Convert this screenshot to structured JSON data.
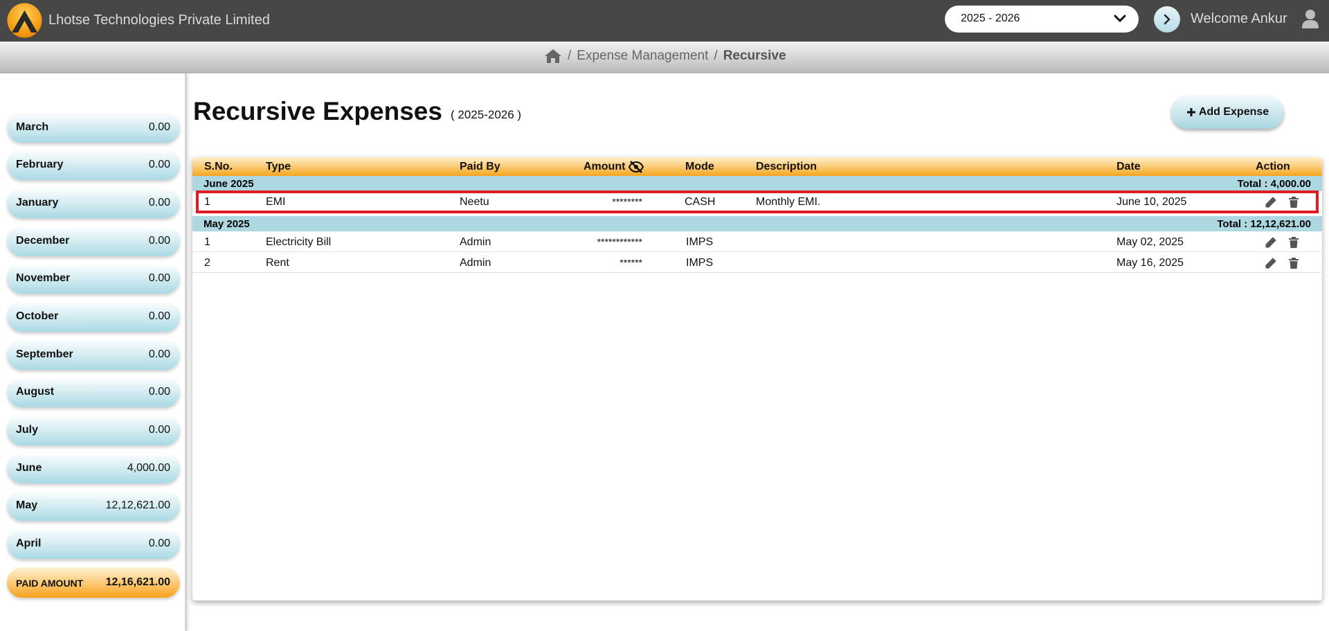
{
  "header": {
    "company": "Lhotse Technologies Private Limited",
    "financial_year": "2025 - 2026",
    "welcome": "Welcome Ankur"
  },
  "breadcrumb": {
    "section": "Expense Management",
    "current": "Recursive"
  },
  "sidebar": {
    "months": [
      {
        "name": "March",
        "amount": "0.00"
      },
      {
        "name": "February",
        "amount": "0.00"
      },
      {
        "name": "January",
        "amount": "0.00"
      },
      {
        "name": "December",
        "amount": "0.00"
      },
      {
        "name": "November",
        "amount": "0.00"
      },
      {
        "name": "October",
        "amount": "0.00"
      },
      {
        "name": "September",
        "amount": "0.00"
      },
      {
        "name": "August",
        "amount": "0.00"
      },
      {
        "name": "July",
        "amount": "0.00"
      },
      {
        "name": "June",
        "amount": "4,000.00"
      },
      {
        "name": "May",
        "amount": "12,12,621.00"
      },
      {
        "name": "April",
        "amount": "0.00"
      }
    ],
    "paid_label": "PAID AMOUNT",
    "paid_total": "12,16,621.00"
  },
  "page": {
    "title": "Recursive Expenses",
    "subtitle": "( 2025-2026 )",
    "add_button": "Add Expense"
  },
  "table": {
    "columns": {
      "sno": "S.No.",
      "type": "Type",
      "paid_by": "Paid By",
      "amount": "Amount",
      "mode": "Mode",
      "description": "Description",
      "date": "Date",
      "action": "Action"
    },
    "groups": [
      {
        "name": "June 2025",
        "total": "Total : 4,000.00",
        "rows": [
          {
            "sno": "1",
            "type": "EMI",
            "paid_by": "Neetu",
            "amount": "********",
            "mode": "CASH",
            "description": "Monthly EMI.",
            "date": "June 10, 2025"
          }
        ]
      },
      {
        "name": "May 2025",
        "total": "Total : 12,12,621.00",
        "rows": [
          {
            "sno": "1",
            "type": "Electricity Bill",
            "paid_by": "Admin",
            "amount": "************",
            "mode": "IMPS",
            "description": "",
            "date": "May 02, 2025"
          },
          {
            "sno": "2",
            "type": "Rent",
            "paid_by": "Admin",
            "amount": "******",
            "mode": "IMPS",
            "description": "",
            "date": "May 16, 2025"
          }
        ]
      }
    ]
  },
  "colors": {
    "topbar": "#474747",
    "accent_orange": "#f6a51f",
    "accent_blue": "#add8e2",
    "highlight": "#e01b24"
  }
}
